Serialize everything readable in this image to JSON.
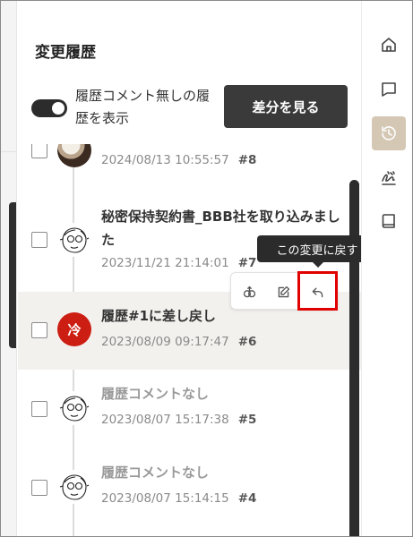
{
  "panel": {
    "title": "変更履歴",
    "toggle_label": "履歴コメント無しの履歴を表示",
    "toggle_on": true,
    "diff_button": "差分を見る"
  },
  "rail": {
    "items": [
      {
        "icon": "home-icon"
      },
      {
        "icon": "comment-icon"
      },
      {
        "icon": "history-icon",
        "active": true
      },
      {
        "icon": "signature-icon"
      },
      {
        "icon": "book-icon"
      }
    ]
  },
  "history": [
    {
      "date": "2024/08/13 10:55:57",
      "number": "#8",
      "avatar": "photo"
    },
    {
      "comment": "秘密保持契約書_BBB社を取り込みました",
      "date": "2023/11/21 21:14:01",
      "number": "#7",
      "avatar": "sketch"
    },
    {
      "comment": "履歴#1に差し戻し",
      "date": "2023/08/09 09:17:47",
      "number": "#6",
      "avatar": "red",
      "avatar_text": "冷"
    },
    {
      "comment": "履歴コメントなし",
      "date": "2023/08/07 15:17:38",
      "number": "#5",
      "avatar": "sketch"
    },
    {
      "comment": "履歴コメントなし",
      "date": "2023/08/07 15:14:15",
      "number": "#4",
      "avatar": "sketch"
    }
  ],
  "tooltip": "この変更に戻す",
  "colors": {
    "accent_active": "#d4c7b4",
    "highlight": "#e00000",
    "red_avatar": "#cc1e12"
  }
}
